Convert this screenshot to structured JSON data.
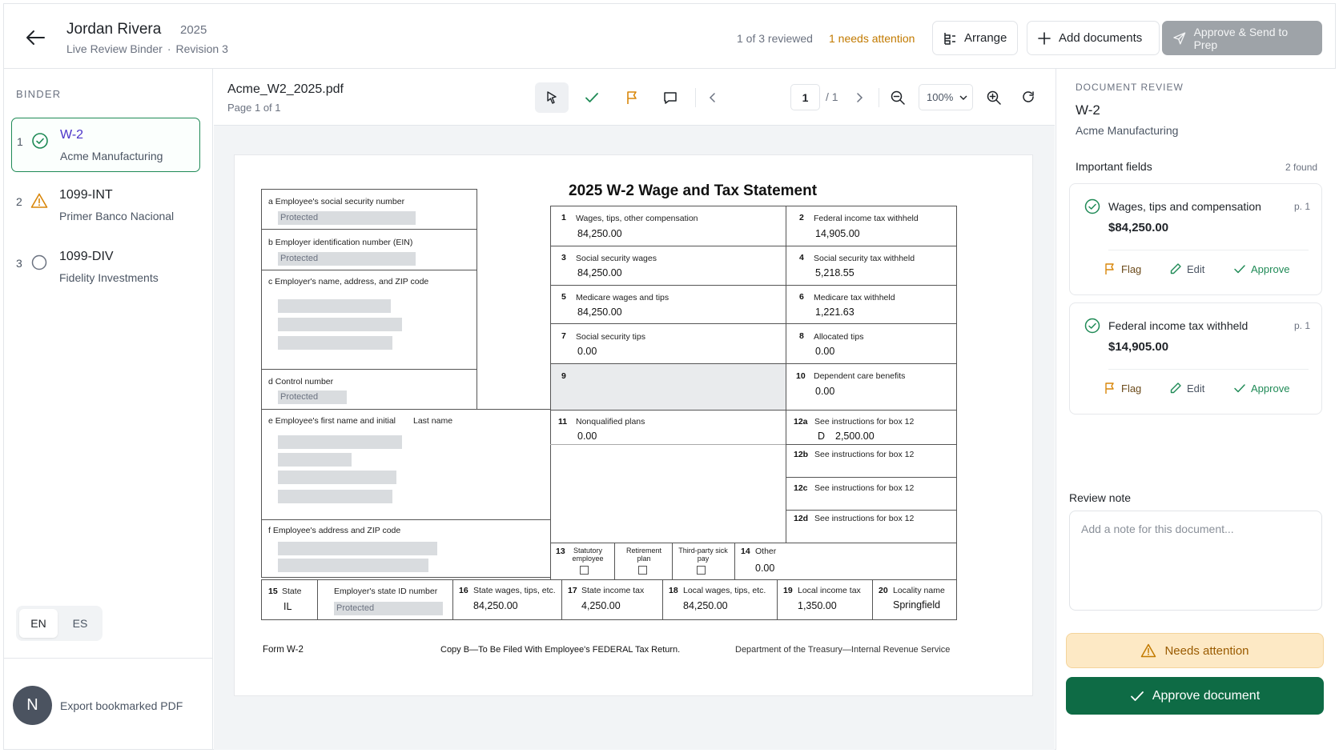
{
  "header": {
    "client_name": "Jordan Rivera",
    "year": "2025",
    "binder": "Live Review Binder",
    "separator": "·",
    "revision": "Revision 3",
    "reviewed": "1 of 3 reviewed",
    "attention": "1 needs attention",
    "arrange_label": "Arrange",
    "add_documents_label": "Add documents",
    "approve_send_label": "Approve & Send to Prep"
  },
  "sidebar": {
    "binder_label": "BINDER",
    "documents": [
      {
        "num": "1",
        "title": "W-2",
        "subtitle": "Acme Manufacturing",
        "status": "approved"
      },
      {
        "num": "2",
        "title": "1099-INT",
        "subtitle": "Primer Banco Nacional",
        "status": "warning"
      },
      {
        "num": "3",
        "title": "1099-DIV",
        "subtitle": "Fidelity Investments",
        "status": "pending"
      }
    ],
    "languages": [
      "EN",
      "ES"
    ],
    "avatar_initial": "N",
    "export_label": "Export bookmarked PDF"
  },
  "viewer": {
    "filename": "Acme_W2_2025.pdf",
    "page_label": "Page 1 of 1",
    "page_current": "1",
    "page_total": "/ 1",
    "zoom": "100%"
  },
  "form": {
    "title": "2025 W-2 Wage and Tax Statement",
    "protected": "Protected",
    "a_label": "a  Employee's social security number",
    "b_label": "b  Employer identification number (EIN)",
    "c_label": "c  Employer's name, address, and ZIP code",
    "d_label": "d  Control number",
    "e_label": "e  Employee's first name and initial",
    "e_last": "Last name",
    "f_label": "f  Employee's address and ZIP code",
    "boxes": {
      "b1": {
        "num": "1",
        "label": "Wages, tips, other compensation",
        "value": "84,250.00"
      },
      "b2": {
        "num": "2",
        "label": "Federal income tax withheld",
        "value": "14,905.00"
      },
      "b3": {
        "num": "3",
        "label": "Social security wages",
        "value": "84,250.00"
      },
      "b4": {
        "num": "4",
        "label": "Social security tax withheld",
        "value": "5,218.55"
      },
      "b5": {
        "num": "5",
        "label": "Medicare wages and tips",
        "value": "84,250.00"
      },
      "b6": {
        "num": "6",
        "label": "Medicare tax withheld",
        "value": "1,221.63"
      },
      "b7": {
        "num": "7",
        "label": "Social security tips",
        "value": "0.00"
      },
      "b8": {
        "num": "8",
        "label": "Allocated tips",
        "value": "0.00"
      },
      "b9": {
        "num": "9"
      },
      "b10": {
        "num": "10",
        "label": "Dependent care benefits",
        "value": "0.00"
      },
      "b11": {
        "num": "11",
        "label": "Nonqualified plans",
        "value": "0.00"
      },
      "b12a": {
        "num": "12a",
        "label": "See instructions for box 12",
        "code": "D",
        "value": "2,500.00"
      },
      "b12b": {
        "num": "12b",
        "label": "See instructions for box 12"
      },
      "b12c": {
        "num": "12c",
        "label": "See instructions for box 12"
      },
      "b12d": {
        "num": "12d",
        "label": "See instructions for box 12"
      },
      "b13": {
        "num": "13",
        "statutory": "Statutory employee",
        "retirement": "Retirement plan",
        "sick": "Third-party sick pay"
      },
      "b14": {
        "num": "14",
        "label": "Other",
        "value": "0.00"
      },
      "b15": {
        "num": "15",
        "label": "State",
        "value": "IL",
        "id_label": "Employer's state ID number"
      },
      "b16": {
        "num": "16",
        "label": "State wages, tips, etc.",
        "value": "84,250.00"
      },
      "b17": {
        "num": "17",
        "label": "State income tax",
        "value": "4,250.00"
      },
      "b18": {
        "num": "18",
        "label": "Local wages, tips, etc.",
        "value": "84,250.00"
      },
      "b19": {
        "num": "19",
        "label": "Local income tax",
        "value": "1,350.00"
      },
      "b20": {
        "num": "20",
        "label": "Locality name",
        "value": "Springfield"
      }
    },
    "footer_left": "Form W-2",
    "footer_center": "Copy B—To Be Filed With Employee's FEDERAL Tax Return.",
    "footer_right": "Department of the Treasury—Internal Revenue Service"
  },
  "review": {
    "section_label": "DOCUMENT REVIEW",
    "doc_title": "W-2",
    "doc_sub": "Acme Manufacturing",
    "important_label": "Important fields",
    "found": "2 found",
    "fields": [
      {
        "name": "Wages, tips and compensation",
        "page": "p. 1",
        "value": "$84,250.00"
      },
      {
        "name": "Federal income tax withheld",
        "page": "p. 1",
        "value": "$14,905.00"
      }
    ],
    "flag_label": "Flag",
    "edit_label": "Edit",
    "approve_label": "Approve",
    "note_label": "Review note",
    "note_placeholder": "Add a note for this document...",
    "needs_attention_label": "Needs attention",
    "approve_document_label": "Approve document"
  },
  "colors": {
    "accent_green": "#0e6b45",
    "success": "#1f8a56",
    "warning": "#d9870b",
    "active_title": "#4b33c9"
  }
}
